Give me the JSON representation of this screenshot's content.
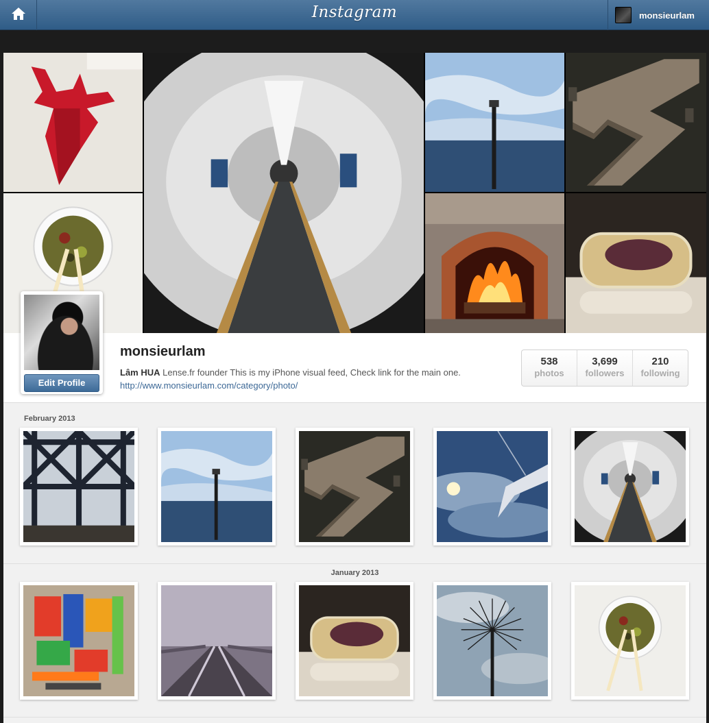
{
  "app": {
    "title": "Instagram"
  },
  "header": {
    "username": "monsieurlam"
  },
  "profile": {
    "username": "monsieurlam",
    "full_name": "Lâm HUA",
    "bio": "Lense.fr founder This is my iPhone visual feed, Check link for the main one.",
    "website": "http://www.monsieurlam.com/category/photo/",
    "edit_label": "Edit Profile",
    "stats": [
      {
        "value": "538",
        "label": "photos"
      },
      {
        "value": "3,699",
        "label": "followers"
      },
      {
        "value": "210",
        "label": "following"
      }
    ]
  },
  "feed": {
    "months": [
      {
        "label": "February 2013",
        "photos": [
          "bridge-girders",
          "sea-post",
          "wooden-walkway",
          "airplane-wing-sky",
          "tunnel"
        ]
      },
      {
        "label": "January 2013",
        "photos": [
          "toy-blasters",
          "train-tracks-blur",
          "rice-cake",
          "dandelion-sculpture",
          "rice-bowl-chopsticks"
        ]
      }
    ]
  },
  "icons": {
    "home": "home-icon"
  },
  "colors": {
    "header": "#3d6a95",
    "link": "#3c6896",
    "button": "#4e7aa8"
  }
}
